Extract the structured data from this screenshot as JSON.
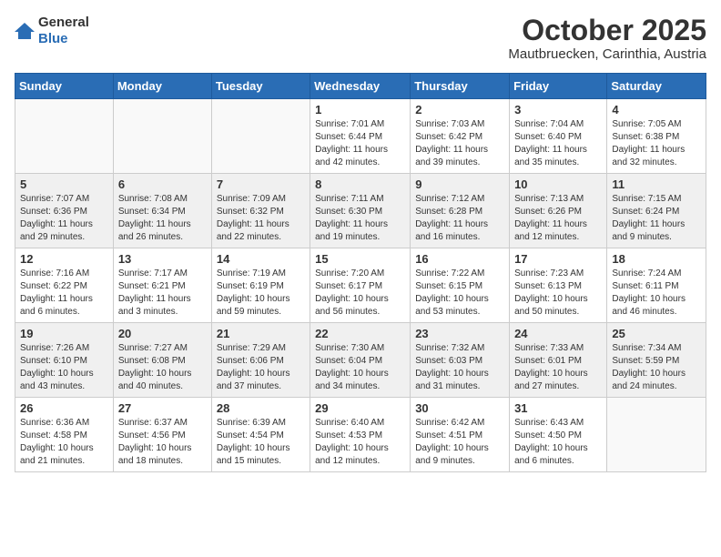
{
  "header": {
    "logo_general": "General",
    "logo_blue": "Blue",
    "month": "October 2025",
    "location": "Mautbruecken, Carinthia, Austria"
  },
  "weekdays": [
    "Sunday",
    "Monday",
    "Tuesday",
    "Wednesday",
    "Thursday",
    "Friday",
    "Saturday"
  ],
  "weeks": [
    [
      {
        "day": "",
        "info": ""
      },
      {
        "day": "",
        "info": ""
      },
      {
        "day": "",
        "info": ""
      },
      {
        "day": "1",
        "info": "Sunrise: 7:01 AM\nSunset: 6:44 PM\nDaylight: 11 hours\nand 42 minutes."
      },
      {
        "day": "2",
        "info": "Sunrise: 7:03 AM\nSunset: 6:42 PM\nDaylight: 11 hours\nand 39 minutes."
      },
      {
        "day": "3",
        "info": "Sunrise: 7:04 AM\nSunset: 6:40 PM\nDaylight: 11 hours\nand 35 minutes."
      },
      {
        "day": "4",
        "info": "Sunrise: 7:05 AM\nSunset: 6:38 PM\nDaylight: 11 hours\nand 32 minutes."
      }
    ],
    [
      {
        "day": "5",
        "info": "Sunrise: 7:07 AM\nSunset: 6:36 PM\nDaylight: 11 hours\nand 29 minutes."
      },
      {
        "day": "6",
        "info": "Sunrise: 7:08 AM\nSunset: 6:34 PM\nDaylight: 11 hours\nand 26 minutes."
      },
      {
        "day": "7",
        "info": "Sunrise: 7:09 AM\nSunset: 6:32 PM\nDaylight: 11 hours\nand 22 minutes."
      },
      {
        "day": "8",
        "info": "Sunrise: 7:11 AM\nSunset: 6:30 PM\nDaylight: 11 hours\nand 19 minutes."
      },
      {
        "day": "9",
        "info": "Sunrise: 7:12 AM\nSunset: 6:28 PM\nDaylight: 11 hours\nand 16 minutes."
      },
      {
        "day": "10",
        "info": "Sunrise: 7:13 AM\nSunset: 6:26 PM\nDaylight: 11 hours\nand 12 minutes."
      },
      {
        "day": "11",
        "info": "Sunrise: 7:15 AM\nSunset: 6:24 PM\nDaylight: 11 hours\nand 9 minutes."
      }
    ],
    [
      {
        "day": "12",
        "info": "Sunrise: 7:16 AM\nSunset: 6:22 PM\nDaylight: 11 hours\nand 6 minutes."
      },
      {
        "day": "13",
        "info": "Sunrise: 7:17 AM\nSunset: 6:21 PM\nDaylight: 11 hours\nand 3 minutes."
      },
      {
        "day": "14",
        "info": "Sunrise: 7:19 AM\nSunset: 6:19 PM\nDaylight: 10 hours\nand 59 minutes."
      },
      {
        "day": "15",
        "info": "Sunrise: 7:20 AM\nSunset: 6:17 PM\nDaylight: 10 hours\nand 56 minutes."
      },
      {
        "day": "16",
        "info": "Sunrise: 7:22 AM\nSunset: 6:15 PM\nDaylight: 10 hours\nand 53 minutes."
      },
      {
        "day": "17",
        "info": "Sunrise: 7:23 AM\nSunset: 6:13 PM\nDaylight: 10 hours\nand 50 minutes."
      },
      {
        "day": "18",
        "info": "Sunrise: 7:24 AM\nSunset: 6:11 PM\nDaylight: 10 hours\nand 46 minutes."
      }
    ],
    [
      {
        "day": "19",
        "info": "Sunrise: 7:26 AM\nSunset: 6:10 PM\nDaylight: 10 hours\nand 43 minutes."
      },
      {
        "day": "20",
        "info": "Sunrise: 7:27 AM\nSunset: 6:08 PM\nDaylight: 10 hours\nand 40 minutes."
      },
      {
        "day": "21",
        "info": "Sunrise: 7:29 AM\nSunset: 6:06 PM\nDaylight: 10 hours\nand 37 minutes."
      },
      {
        "day": "22",
        "info": "Sunrise: 7:30 AM\nSunset: 6:04 PM\nDaylight: 10 hours\nand 34 minutes."
      },
      {
        "day": "23",
        "info": "Sunrise: 7:32 AM\nSunset: 6:03 PM\nDaylight: 10 hours\nand 31 minutes."
      },
      {
        "day": "24",
        "info": "Sunrise: 7:33 AM\nSunset: 6:01 PM\nDaylight: 10 hours\nand 27 minutes."
      },
      {
        "day": "25",
        "info": "Sunrise: 7:34 AM\nSunset: 5:59 PM\nDaylight: 10 hours\nand 24 minutes."
      }
    ],
    [
      {
        "day": "26",
        "info": "Sunrise: 6:36 AM\nSunset: 4:58 PM\nDaylight: 10 hours\nand 21 minutes."
      },
      {
        "day": "27",
        "info": "Sunrise: 6:37 AM\nSunset: 4:56 PM\nDaylight: 10 hours\nand 18 minutes."
      },
      {
        "day": "28",
        "info": "Sunrise: 6:39 AM\nSunset: 4:54 PM\nDaylight: 10 hours\nand 15 minutes."
      },
      {
        "day": "29",
        "info": "Sunrise: 6:40 AM\nSunset: 4:53 PM\nDaylight: 10 hours\nand 12 minutes."
      },
      {
        "day": "30",
        "info": "Sunrise: 6:42 AM\nSunset: 4:51 PM\nDaylight: 10 hours\nand 9 minutes."
      },
      {
        "day": "31",
        "info": "Sunrise: 6:43 AM\nSunset: 4:50 PM\nDaylight: 10 hours\nand 6 minutes."
      },
      {
        "day": "",
        "info": ""
      }
    ]
  ]
}
